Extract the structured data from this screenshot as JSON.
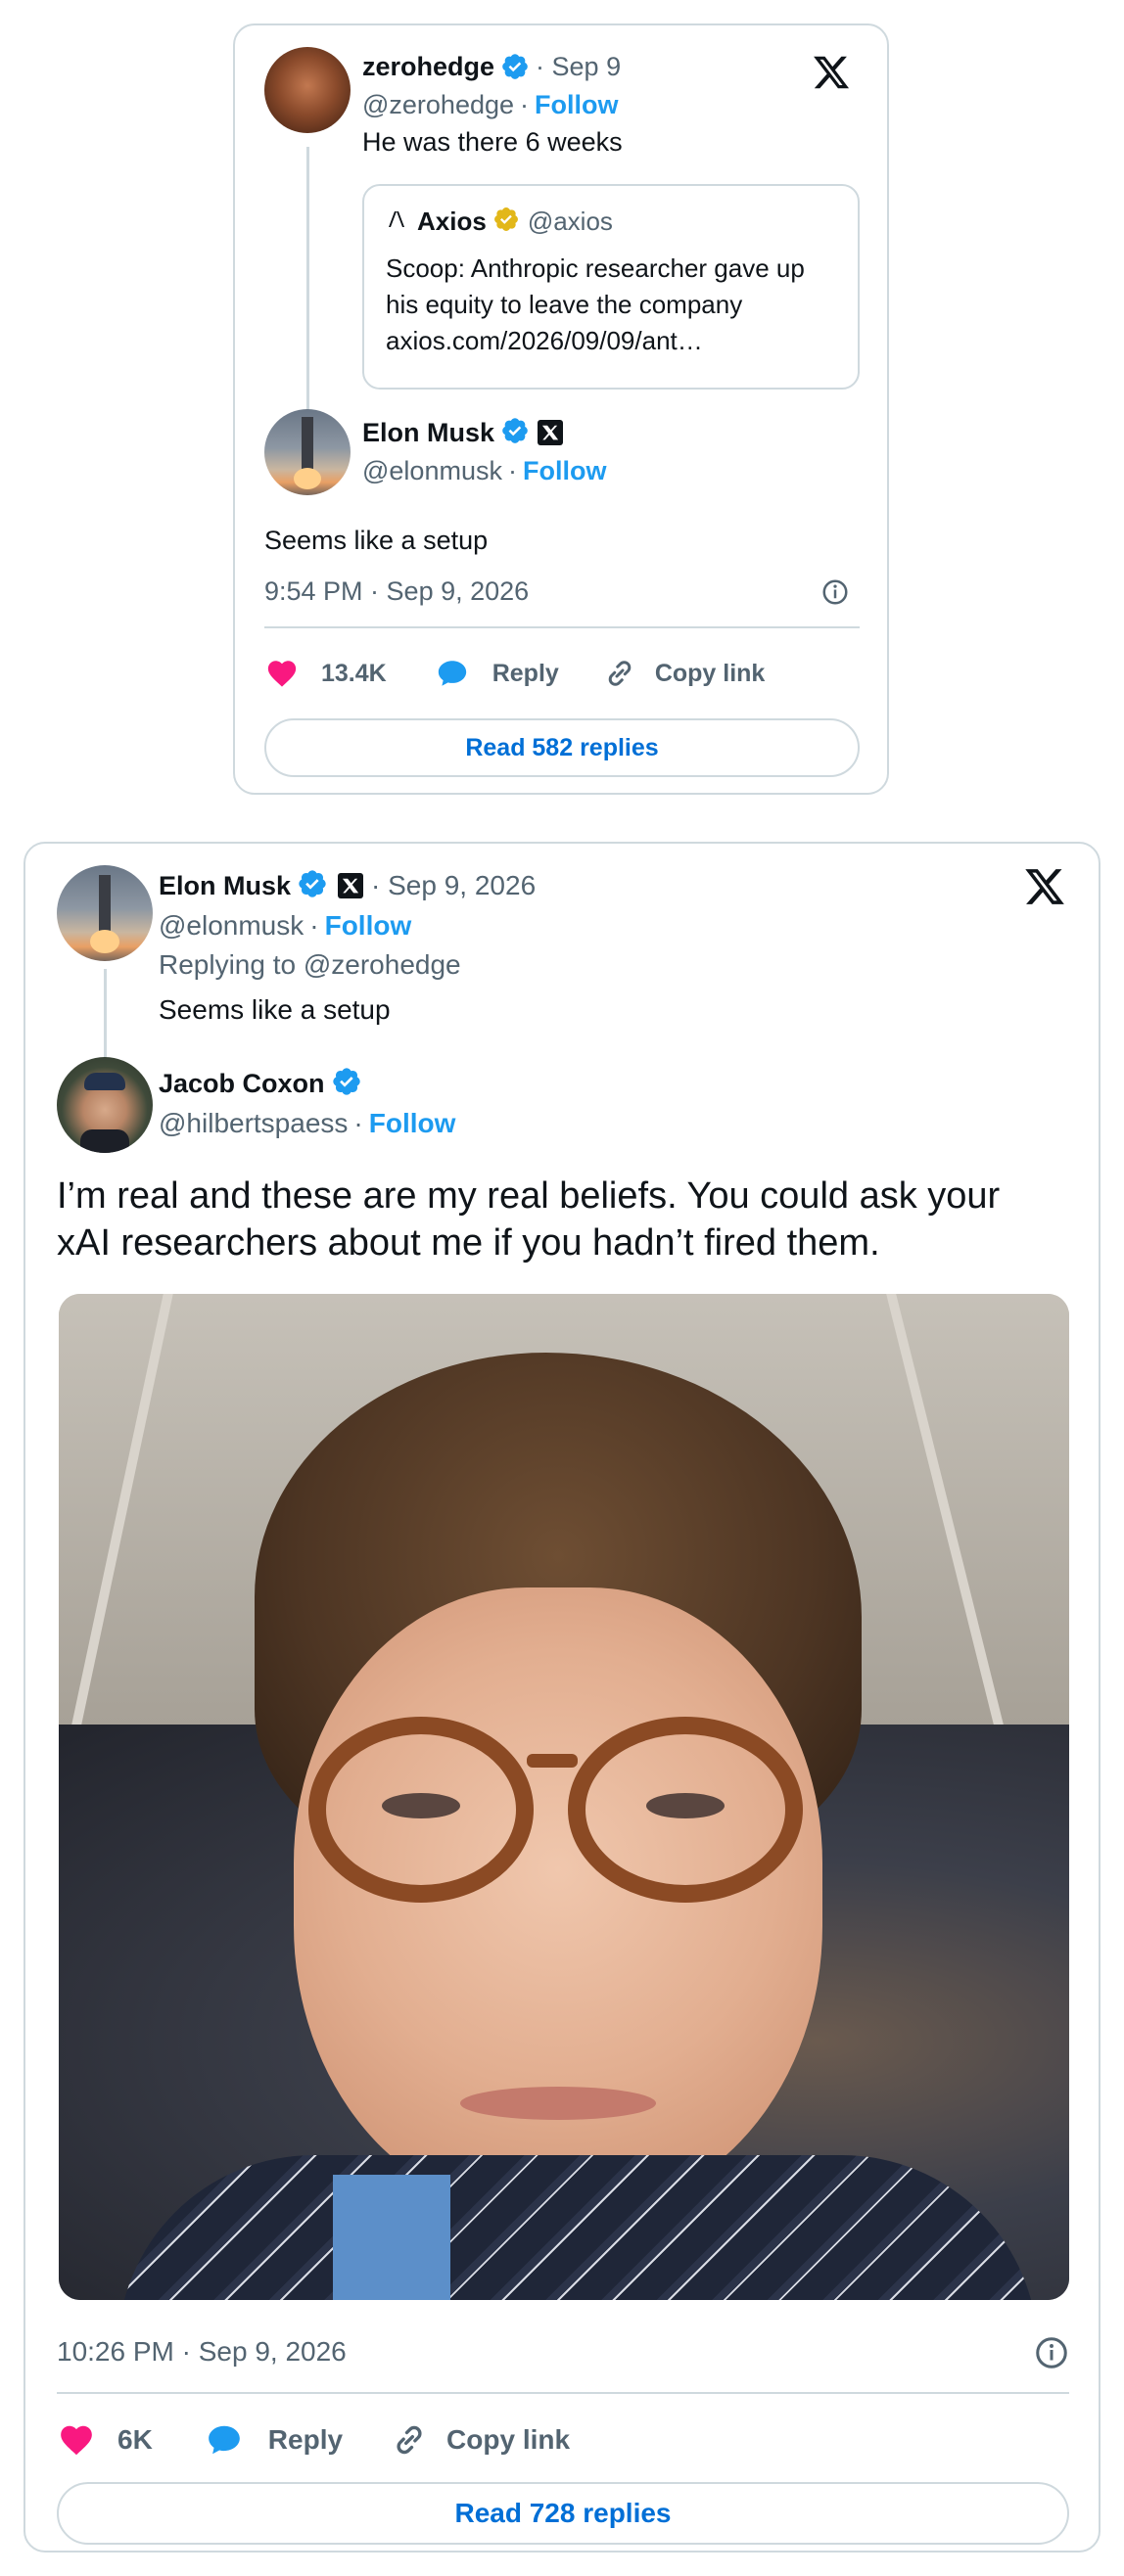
{
  "tweet1": {
    "quoted_author": {
      "name": "zerohedge",
      "date": "· Sep 9",
      "handle": "@zerohedge",
      "follow": "Follow",
      "text": "He was there 6 weeks"
    },
    "quote_card": {
      "name": "Axios",
      "handle": "@axios",
      "text_lines": [
        "Scoop: Anthropic researcher gave up",
        "his equity to leave the company",
        "axios.com/2026/09/09/ant…"
      ]
    },
    "author": {
      "name": "Elon Musk",
      "handle": "@elonmusk",
      "follow": "Follow"
    },
    "text": "Seems like a setup",
    "timestamp": "9:54 PM · Sep 9, 2026",
    "likes": "13.4K",
    "reply_label": "Reply",
    "copy_link_label": "Copy link",
    "read_replies": "Read 582 replies"
  },
  "tweet2": {
    "parent": {
      "name": "Elon Musk",
      "date": "· Sep 9, 2026",
      "handle": "@elonmusk",
      "follow": "Follow",
      "replying_to": "Replying to @zerohedge",
      "text": "Seems like a setup"
    },
    "author": {
      "name": "Jacob Coxon",
      "handle": "@hilbertspaess",
      "follow": "Follow"
    },
    "text_lines": [
      "I’m real and these are my real beliefs. You could ask your",
      "xAI researchers about me if you hadn’t fired them."
    ],
    "timestamp": "10:26 PM · Sep 9, 2026",
    "likes": "6K",
    "reply_label": "Reply",
    "copy_link_label": "Copy link",
    "read_replies": "Read 728 replies"
  },
  "icons": {
    "x_logo": "x-logo-icon",
    "verified": "verified-badge-icon",
    "gold_verified": "gold-verified-badge-icon",
    "like": "heart-icon",
    "reply": "speech-bubble-icon",
    "copy": "link-icon",
    "info": "info-icon"
  },
  "colors": {
    "blue": "#1d9bf0",
    "like_pink": "#f91880",
    "text": "#0f1419",
    "muted": "#536471",
    "border": "#cfd9de"
  }
}
